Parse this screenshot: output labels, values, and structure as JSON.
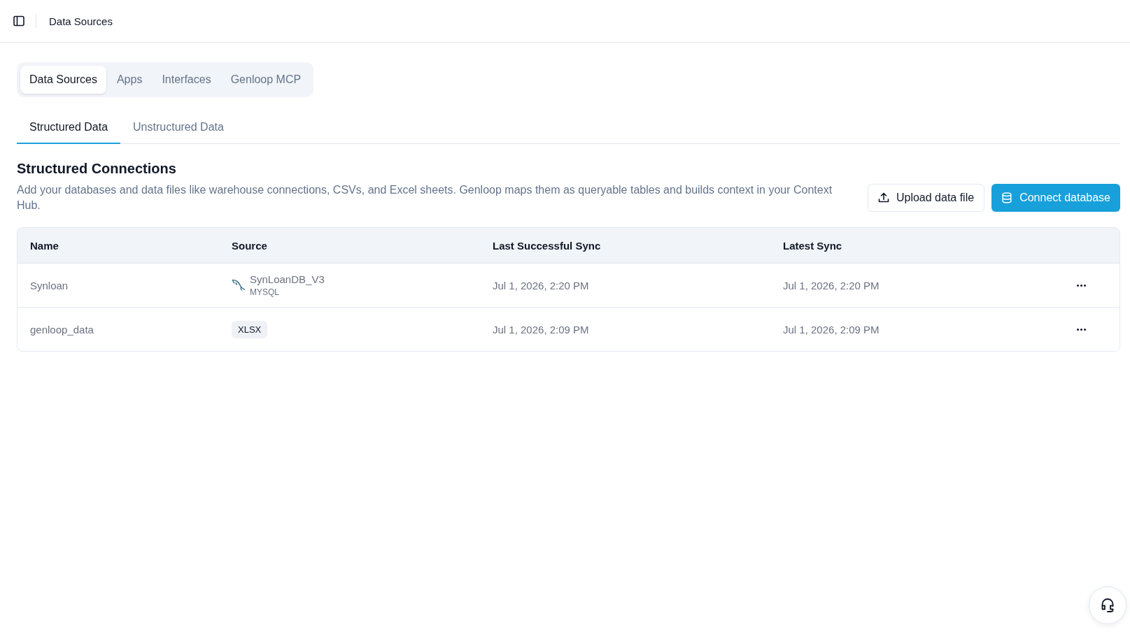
{
  "header": {
    "title": "Data Sources"
  },
  "main_tabs": [
    {
      "label": "Data Sources",
      "selected": true
    },
    {
      "label": "Apps",
      "selected": false
    },
    {
      "label": "Interfaces",
      "selected": false
    },
    {
      "label": "Genloop MCP",
      "selected": false
    }
  ],
  "sub_tabs": [
    {
      "label": "Structured Data",
      "selected": true
    },
    {
      "label": "Unstructured Data",
      "selected": false
    }
  ],
  "section": {
    "title": "Structured Connections",
    "description": "Add your databases and data files like warehouse connections, CSVs, and Excel sheets. Genloop maps them as queryable tables and builds context in your Context Hub."
  },
  "actions": [
    {
      "label": "Upload data file",
      "kind": "secondary"
    },
    {
      "label": "Connect database",
      "kind": "primary"
    }
  ],
  "table": {
    "columns": [
      "Name",
      "Source",
      "Last Successful Sync",
      "Latest Sync"
    ],
    "rows": [
      {
        "name": "Synloan",
        "source": {
          "kind": "database",
          "name": "SynLoanDB_V3",
          "type": "MYSQL"
        },
        "last_successful_sync": "Jul 1, 2026, 2:20 PM",
        "latest_sync": "Jul 1, 2026, 2:20 PM"
      },
      {
        "name": "genloop_data",
        "source": {
          "kind": "file",
          "name": "XLSX"
        },
        "last_successful_sync": "Jul 1, 2026, 2:09 PM",
        "latest_sync": "Jul 1, 2026, 2:09 PM"
      }
    ]
  }
}
